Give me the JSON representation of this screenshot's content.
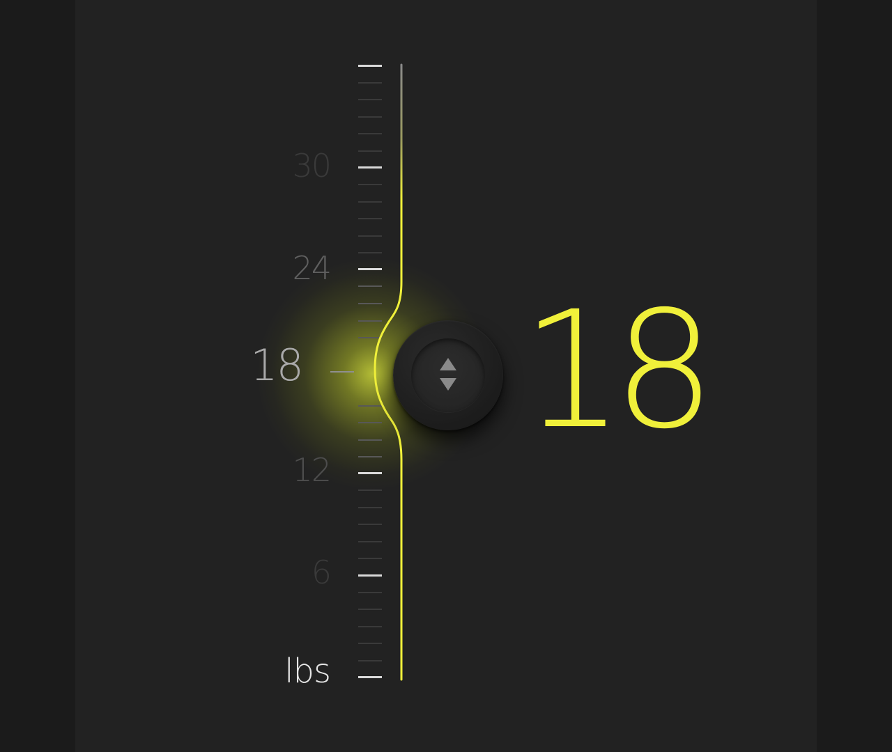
{
  "slider": {
    "unit": "lbs",
    "value": 18,
    "value_display": "18",
    "min": 0,
    "max": 36,
    "scale_labels": [
      "30",
      "24",
      "18",
      "12",
      "6"
    ],
    "icons": {
      "knob_up": "arrow-up-icon",
      "knob_down": "arrow-down-icon"
    }
  },
  "colors": {
    "background": "#222222",
    "accent": "#f0f03a",
    "track_inactive": "#8a8a8a",
    "tick": "#3a3a3a",
    "tick_major": "#dadada"
  }
}
